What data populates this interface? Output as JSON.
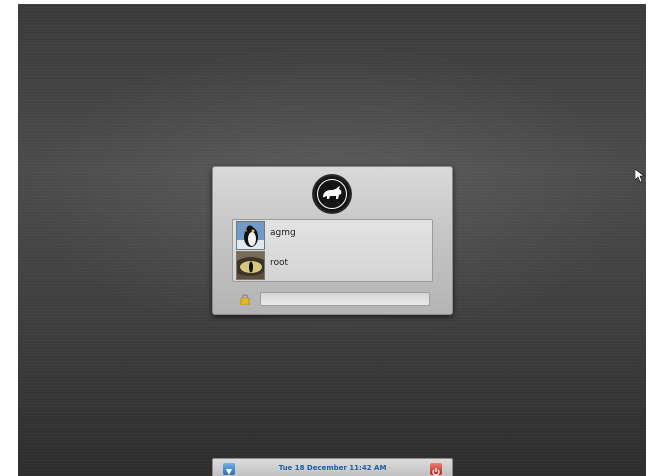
{
  "users": [
    {
      "name": "agmg",
      "avatar_icon": "penguin-avatar-icon"
    },
    {
      "name": "root",
      "avatar_icon": "cat-eye-avatar-icon"
    }
  ],
  "password": {
    "value": ""
  },
  "clock": {
    "text": "Tue 18 December 11:42 AM"
  },
  "colors": {
    "background": "#3f3f3f",
    "panel": "#c8c8c8",
    "clock_text": "#1c5fa3",
    "power_button": "#c0392b",
    "menu_button": "#3f87d0"
  },
  "icons": {
    "logo": "bull-logo-icon",
    "lock": "padlock-icon",
    "menu": "shield-menu-icon",
    "power": "power-icon",
    "cursor": "mouse-pointer-icon"
  }
}
